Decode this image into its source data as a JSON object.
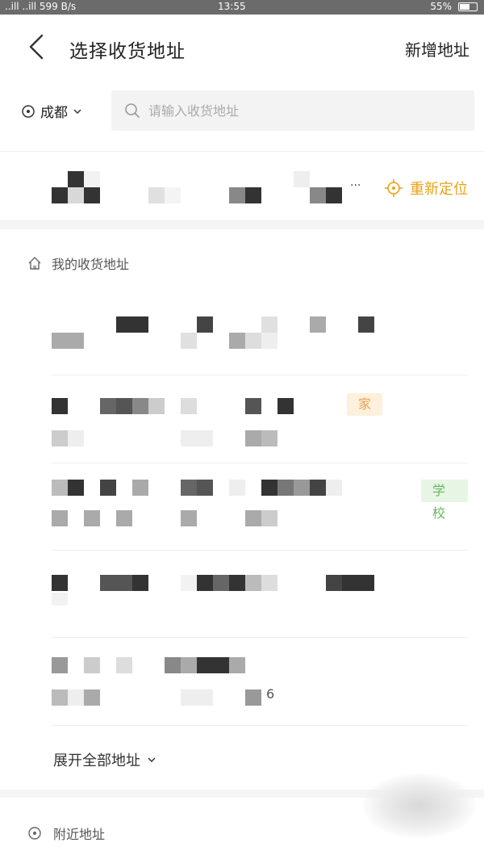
{
  "status_bar": {
    "carrier": "..ill ..ill ",
    "speed": "599 B/s",
    "time": "13:55",
    "battery": "55%"
  },
  "header": {
    "title": "选择收货地址",
    "new_address_label": "新增地址"
  },
  "search": {
    "city": "成都",
    "placeholder": "请输入收货地址"
  },
  "current_location": {
    "relocate_label": "重新定位",
    "dots": "···"
  },
  "my_addresses": {
    "title": "我的收货地址",
    "items": [
      {
        "tag": ""
      },
      {
        "tag": "家"
      },
      {
        "tag": "学校"
      },
      {
        "tag": ""
      },
      {
        "tag": "",
        "trailing_digit": "6"
      }
    ],
    "expand_label": "展开全部地址"
  },
  "nearby": {
    "title": "附近地址"
  },
  "colors": {
    "accent": "#e8a317",
    "home_tag_bg": "#fdf0dc",
    "home_tag_text": "#e6a45a",
    "school_tag_bg": "#e7f5e4",
    "school_tag_text": "#68b85d"
  }
}
